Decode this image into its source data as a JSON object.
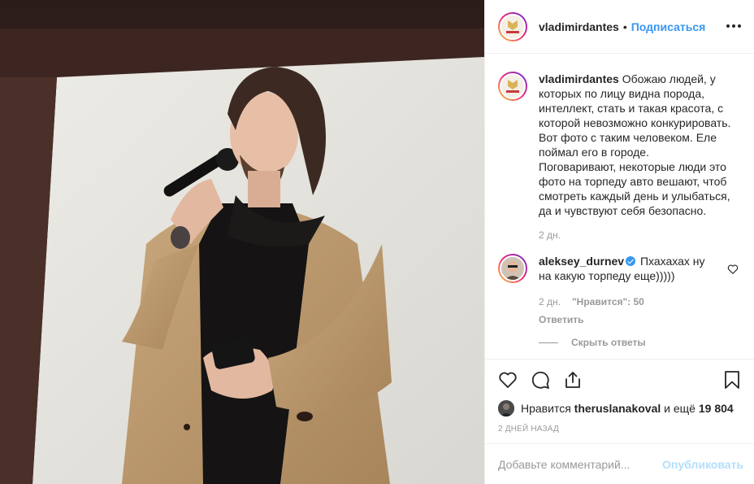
{
  "post": {
    "author": "vladimirdantes",
    "follow_label": "Подписаться",
    "separator": "•"
  },
  "caption": {
    "username": "vladimirdantes",
    "text": "Обожаю людей, у которых по лицу видна порода, интеллект, стать и такая красота, с которой невозможно конкурировать. Вот фото с таким человеком. Еле поймал его в городе.\nПоговаривают, некоторые люди это фото на торпеду авто вешают, чтоб смотреть каждый день и улыбаться, да и чувствуют себя безопасно.",
    "time": "2 дн."
  },
  "comment": {
    "username": "aleksey_durnev",
    "text": "Пхахахах ну на какую торпеду еще)))))",
    "time": "2 дн.",
    "likes_label": "\"Нравится\": 50",
    "reply_label": "Ответить",
    "hide_replies_label": "Скрыть ответы"
  },
  "likes": {
    "prefix": "Нравится",
    "user": "theruslanakoval",
    "and_more": "и ещё",
    "count": "19 804"
  },
  "date_label": "2 дней назад",
  "add_comment": {
    "placeholder": "Добавьте комментарий...",
    "publish_label": "Опубликовать"
  },
  "icons": [
    "more-icon",
    "heart-icon",
    "comment-icon",
    "share-icon",
    "bookmark-icon",
    "verified-icon"
  ],
  "colors": {
    "link": "#3897f0",
    "muted": "#999999",
    "publish_disabled": "#b2dffc",
    "text": "#262626"
  }
}
